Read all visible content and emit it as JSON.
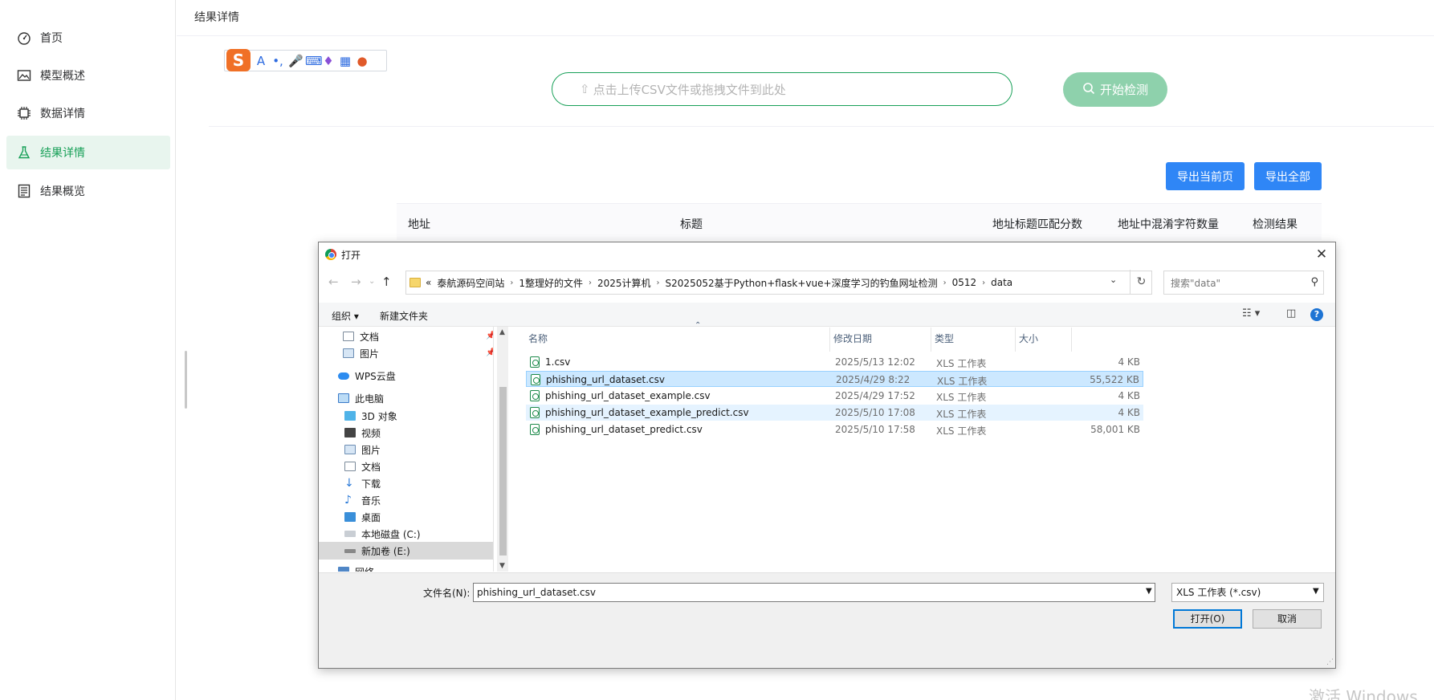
{
  "sidebar": {
    "items": [
      {
        "label": "首页",
        "icon": "dashboard-icon"
      },
      {
        "label": "模型概述",
        "icon": "image-icon"
      },
      {
        "label": "数据详情",
        "icon": "chip-icon"
      },
      {
        "label": "结果详情",
        "icon": "flask-icon",
        "active": true
      },
      {
        "label": "结果概览",
        "icon": "document-icon"
      }
    ]
  },
  "header": {
    "title": "结果详情"
  },
  "upload": {
    "placeholder": "点击上传CSV文件或拖拽文件到此处",
    "detect_label": "开始检测"
  },
  "export": {
    "current_page": "导出当前页",
    "all": "导出全部"
  },
  "table": {
    "columns": [
      "地址",
      "标题",
      "地址标题匹配分数",
      "地址中混淆字符数量",
      "检测结果"
    ]
  },
  "dialog": {
    "title": "打开",
    "breadcrumb": [
      "泰航源码空间站",
      "1整理好的文件",
      "2025计算机",
      "S2025052基于Python+flask+vue+深度学习的钓鱼网址检测",
      "0512",
      "data"
    ],
    "breadcrumb_prefix": "«",
    "search_placeholder": "搜索\"data\"",
    "organize": "组织 ▾",
    "new_folder": "新建文件夹",
    "tree": [
      {
        "label": "文档",
        "icon": "document-icon",
        "pinned": true
      },
      {
        "label": "图片",
        "icon": "picture-icon",
        "pinned": true
      },
      {
        "label": "WPS云盘",
        "icon": "cloud-icon"
      },
      {
        "label": "此电脑",
        "icon": "computer-icon"
      },
      {
        "label": "3D 对象",
        "icon": "cube-icon"
      },
      {
        "label": "视频",
        "icon": "video-icon"
      },
      {
        "label": "图片",
        "icon": "picture-icon"
      },
      {
        "label": "文档",
        "icon": "document-icon"
      },
      {
        "label": "下载",
        "icon": "download-icon"
      },
      {
        "label": "音乐",
        "icon": "music-icon"
      },
      {
        "label": "桌面",
        "icon": "desktop-icon"
      },
      {
        "label": "本地磁盘 (C:)",
        "icon": "drive-icon"
      },
      {
        "label": "新加卷 (E:)",
        "icon": "drive-icon",
        "selected": true
      },
      {
        "label": "网络",
        "icon": "network-icon"
      }
    ],
    "list_headers": {
      "name": "名称",
      "date": "修改日期",
      "type": "类型",
      "size": "大小"
    },
    "files": [
      {
        "name": "1.csv",
        "date": "2025/5/13 12:02",
        "type": "XLS 工作表",
        "size": "4 KB",
        "state": ""
      },
      {
        "name": "phishing_url_dataset.csv",
        "date": "2025/4/29 8:22",
        "type": "XLS 工作表",
        "size": "55,522 KB",
        "state": "sel"
      },
      {
        "name": "phishing_url_dataset_example.csv",
        "date": "2025/4/29 17:52",
        "type": "XLS 工作表",
        "size": "4 KB",
        "state": ""
      },
      {
        "name": "phishing_url_dataset_example_predict.csv",
        "date": "2025/5/10 17:08",
        "type": "XLS 工作表",
        "size": "4 KB",
        "state": "hl"
      },
      {
        "name": "phishing_url_dataset_predict.csv",
        "date": "2025/5/10 17:58",
        "type": "XLS 工作表",
        "size": "58,001 KB",
        "state": ""
      }
    ],
    "filename_label": "文件名(N):",
    "filename_value": "phishing_url_dataset.csv",
    "filetype": "XLS 工作表 (*.csv)",
    "open_label": "打开(O)",
    "cancel_label": "取消"
  },
  "watermark": "激活 Windows"
}
